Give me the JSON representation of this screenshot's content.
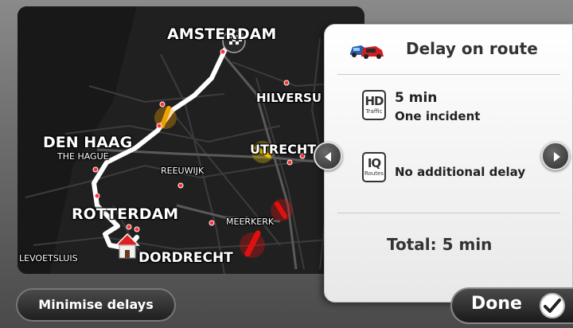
{
  "map": {
    "cities": {
      "amsterdam": "AMSTERDAM",
      "hilversum": "HILVERSU",
      "den_haag": "DEN HAAG",
      "the_hague": "THE HAGUE",
      "utrecht": "UTRECHT",
      "reeuwijk": "REEUWIJK",
      "rotterdam": "ROTTERDAM",
      "meerkerk": "MEERKERK",
      "hellevoetsluis": "LEVOETSLUIS",
      "dordrecht": "DORDRECHT"
    },
    "route_color": "#ffffff",
    "incident_colors": {
      "minor": "#f0a000",
      "major": "#e01010"
    }
  },
  "panel": {
    "title": "Delay on route",
    "hd_traffic": {
      "badge_main": "HD",
      "badge_sub": "Traffic",
      "delay": "5 min",
      "detail": "One incident"
    },
    "iq_routes": {
      "badge_main": "IQ",
      "badge_sub": "Routes",
      "detail": "No additional delay"
    },
    "total": "Total:  5 min"
  },
  "buttons": {
    "minimise": "Minimise delays",
    "done": "Done"
  }
}
